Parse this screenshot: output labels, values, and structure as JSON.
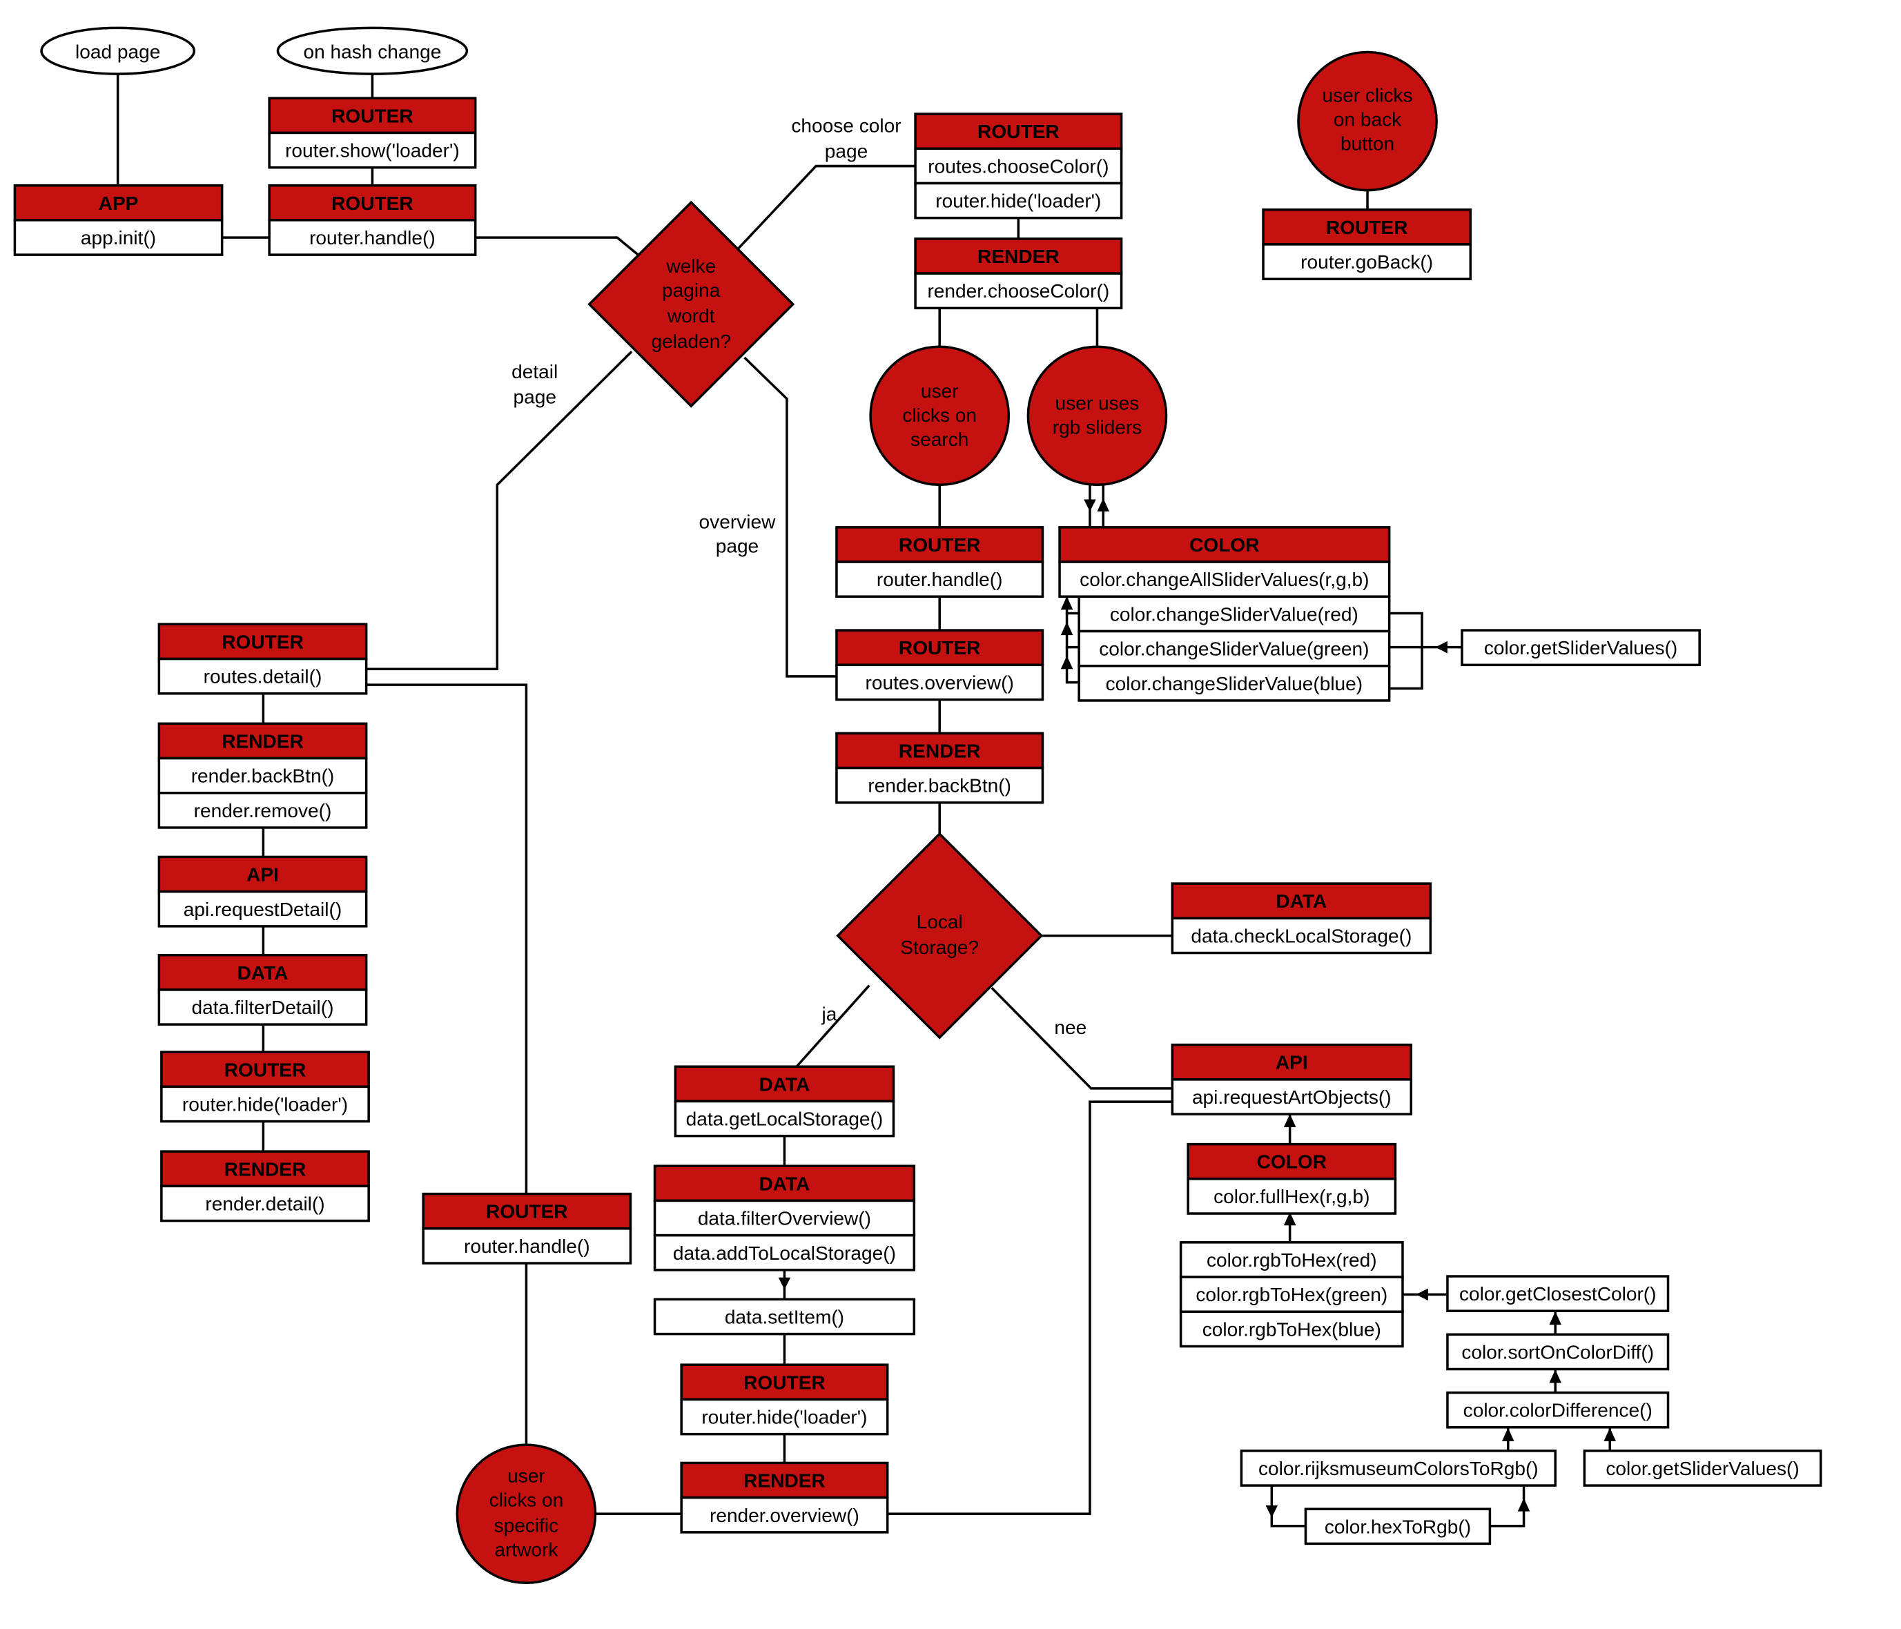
{
  "colors": {
    "accent": "#C61111",
    "stroke": "#000000",
    "background": "#FFFFFF"
  },
  "events": {
    "load_page": "load page",
    "hash_change": "on hash change",
    "back_button": [
      "user clicks",
      "on back",
      "button"
    ],
    "search_click": [
      "user",
      "clicks on",
      "search"
    ],
    "rgb_sliders": [
      "user uses",
      "rgb sliders"
    ],
    "artwork_click": [
      "user",
      "clicks on",
      "specific",
      "artwork"
    ]
  },
  "decisions": {
    "page": [
      "welke",
      "pagina",
      "wordt",
      "geladen?"
    ],
    "storage": [
      "Local",
      "Storage?"
    ]
  },
  "edge_labels": {
    "choose_color": [
      "choose color",
      "page"
    ],
    "detail": [
      "detail",
      "page"
    ],
    "overview": [
      "overview",
      "page"
    ],
    "yes": "ja",
    "no": "nee"
  },
  "modules": {
    "app": {
      "title": "APP",
      "methods": [
        "app.init()"
      ]
    },
    "router_show": {
      "title": "ROUTER",
      "methods": [
        "router.show('loader')"
      ]
    },
    "router_handle_top": {
      "title": "ROUTER",
      "methods": [
        "router.handle()"
      ]
    },
    "router_choose": {
      "title": "ROUTER",
      "methods": [
        "routes.chooseColor()",
        "router.hide('loader')"
      ]
    },
    "render_choose": {
      "title": "RENDER",
      "methods": [
        "render.chooseColor()"
      ]
    },
    "router_goback": {
      "title": "ROUTER",
      "methods": [
        "router.goBack()"
      ]
    },
    "router_handle_mid": {
      "title": "ROUTER",
      "methods": [
        "router.handle()"
      ]
    },
    "color_sliders": {
      "title": "COLOR",
      "methods": [
        "color.changeAllSliderValues(r,g,b)"
      ],
      "sub_methods": [
        "color.changeSliderValue(red)",
        "color.changeSliderValue(green)",
        "color.changeSliderValue(blue)"
      ]
    },
    "get_slider_values_top": {
      "methods": [
        "color.getSliderValues()"
      ]
    },
    "router_overview": {
      "title": "ROUTER",
      "methods": [
        "routes.overview()"
      ]
    },
    "render_backbtn_overview": {
      "title": "RENDER",
      "methods": [
        "render.backBtn()"
      ]
    },
    "data_check": {
      "title": "DATA",
      "methods": [
        "data.checkLocalStorage()"
      ]
    },
    "api_art": {
      "title": "API",
      "methods": [
        "api.requestArtObjects()"
      ]
    },
    "color_fullhex": {
      "title": "COLOR",
      "methods": [
        "color.fullHex(r,g,b)"
      ]
    },
    "rgb_to_hex": {
      "methods": [
        "color.rgbToHex(red)",
        "color.rgbToHex(green)",
        "color.rgbToHex(blue)"
      ]
    },
    "closest_color": {
      "methods": [
        "color.getClosestColor()"
      ]
    },
    "sort_diff": {
      "methods": [
        "color.sortOnColorDiff()"
      ]
    },
    "color_diff": {
      "methods": [
        "color.colorDifference()"
      ]
    },
    "rijks_to_rgb": {
      "methods": [
        "color.rijksmuseumColorsToRgb()"
      ]
    },
    "get_slider_values_bottom": {
      "methods": [
        "color.getSliderValues()"
      ]
    },
    "hex_to_rgb": {
      "methods": [
        "color.hexToRgb()"
      ]
    },
    "data_get_local": {
      "title": "DATA",
      "methods": [
        "data.getLocalStorage()"
      ]
    },
    "data_filter_overview": {
      "title": "DATA",
      "methods": [
        "data.filterOverview()",
        "data.addToLocalStorage()"
      ]
    },
    "data_setitem": {
      "methods": [
        "data.setItem()"
      ]
    },
    "router_hide_overview": {
      "title": "ROUTER",
      "methods": [
        "router.hide('loader')"
      ]
    },
    "render_overview": {
      "title": "RENDER",
      "methods": [
        "render.overview()"
      ]
    },
    "router_handle_artwork": {
      "title": "ROUTER",
      "methods": [
        "router.handle()"
      ]
    },
    "router_detail": {
      "title": "ROUTER",
      "methods": [
        "routes.detail()"
      ]
    },
    "render_detail_prep": {
      "title": "RENDER",
      "methods": [
        "render.backBtn()",
        "render.remove()"
      ]
    },
    "api_detail": {
      "title": "API",
      "methods": [
        "api.requestDetail()"
      ]
    },
    "data_filter_detail": {
      "title": "DATA",
      "methods": [
        "data.filterDetail()"
      ]
    },
    "router_hide_detail": {
      "title": "ROUTER",
      "methods": [
        "router.hide('loader')"
      ]
    },
    "render_detail": {
      "title": "RENDER",
      "methods": [
        "render.detail()"
      ]
    }
  }
}
